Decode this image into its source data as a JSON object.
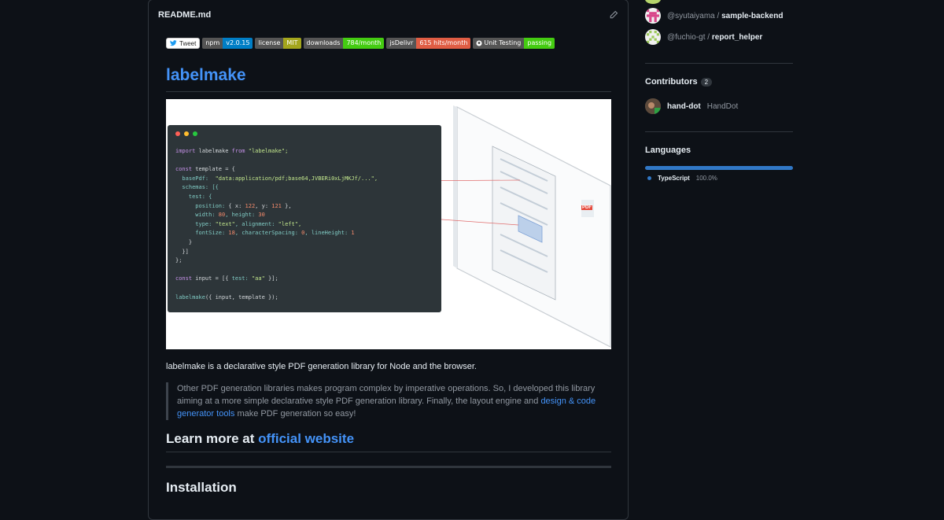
{
  "readme": {
    "filename": "README.md",
    "badges": [
      {
        "left": "npm",
        "right": "v2.0.15",
        "color": "#007ec6"
      },
      {
        "left": "license",
        "right": "MIT",
        "color": "#a4a61d"
      },
      {
        "left": "downloads",
        "right": "784/month",
        "color": "#4c1"
      },
      {
        "left": "jsDelivr",
        "right": "615 hits/month",
        "color": "#e05d44"
      },
      {
        "left": "Unit Testing",
        "right": "passing",
        "color": "#4c1"
      }
    ],
    "tweet_label": "Tweet",
    "title": "labelmake",
    "code_lines": {
      "l1a": "import",
      "l1b": " labelmake ",
      "l1c": "from",
      "l1d": " \"labelmake\";",
      "l3a": "const",
      "l3b": " template = {",
      "l4a": "  basePdf:",
      "l4b": "  \"data:application/pdf;base64,JVBERi0xLjMKJf/...\",",
      "l5": "  schemas: [{",
      "l6": "    test: {",
      "l7a": "      position:",
      "l7b": " { x: ",
      "l7c": "122",
      "l7d": ", y: ",
      "l7e": "121",
      "l7f": " },",
      "l8a": "      width:",
      "l8b": " 80",
      "l8c": ", height:",
      "l8d": " 30",
      "l9a": "      type:",
      "l9b": " \"text\"",
      "l9c": ", alignment:",
      "l9d": " \"left\",",
      "l10a": "      fontSize:",
      "l10b": " 18",
      "l10c": ", characterSpacing:",
      "l10d": " 0",
      "l10e": ", lineHeight:",
      "l10f": " 1",
      "l11": "    }",
      "l12": "  }]",
      "l13": "};",
      "l15a": "const",
      "l15b": " input = [{ ",
      "l15c": "test:",
      "l15d": " \"aa\"",
      "l15e": " }];",
      "l17a": "labelmake",
      "l17b": "({ input, template });"
    },
    "pdf_label": "PDF",
    "description": "labelmake is a declarative style PDF generation library for Node and the browser.",
    "quote_text": "Other PDF generation libraries makes program complex by imperative operations. So, I developed this library aiming at a more simple declarative style PDF generation library. Finally, the layout engine and",
    "quote_link": "design & code generator tools",
    "quote_tail": " make PDF generation so easy!",
    "learn_prefix": "Learn more at ",
    "learn_link": "official website",
    "install_heading": "Installation"
  },
  "sidebar": {
    "dependents": [
      {
        "owner": "@syutaiyama",
        "repo": "sample-backend"
      },
      {
        "owner": "@fuchio-gt",
        "repo": "report_helper"
      }
    ],
    "separator": "/",
    "contributors_heading": "Contributors",
    "contributors_count": "2",
    "contributor": {
      "login": "hand-dot",
      "name": "HandDot"
    },
    "languages_heading": "Languages",
    "language": {
      "name": "TypeScript",
      "percent": "100.0%"
    }
  }
}
